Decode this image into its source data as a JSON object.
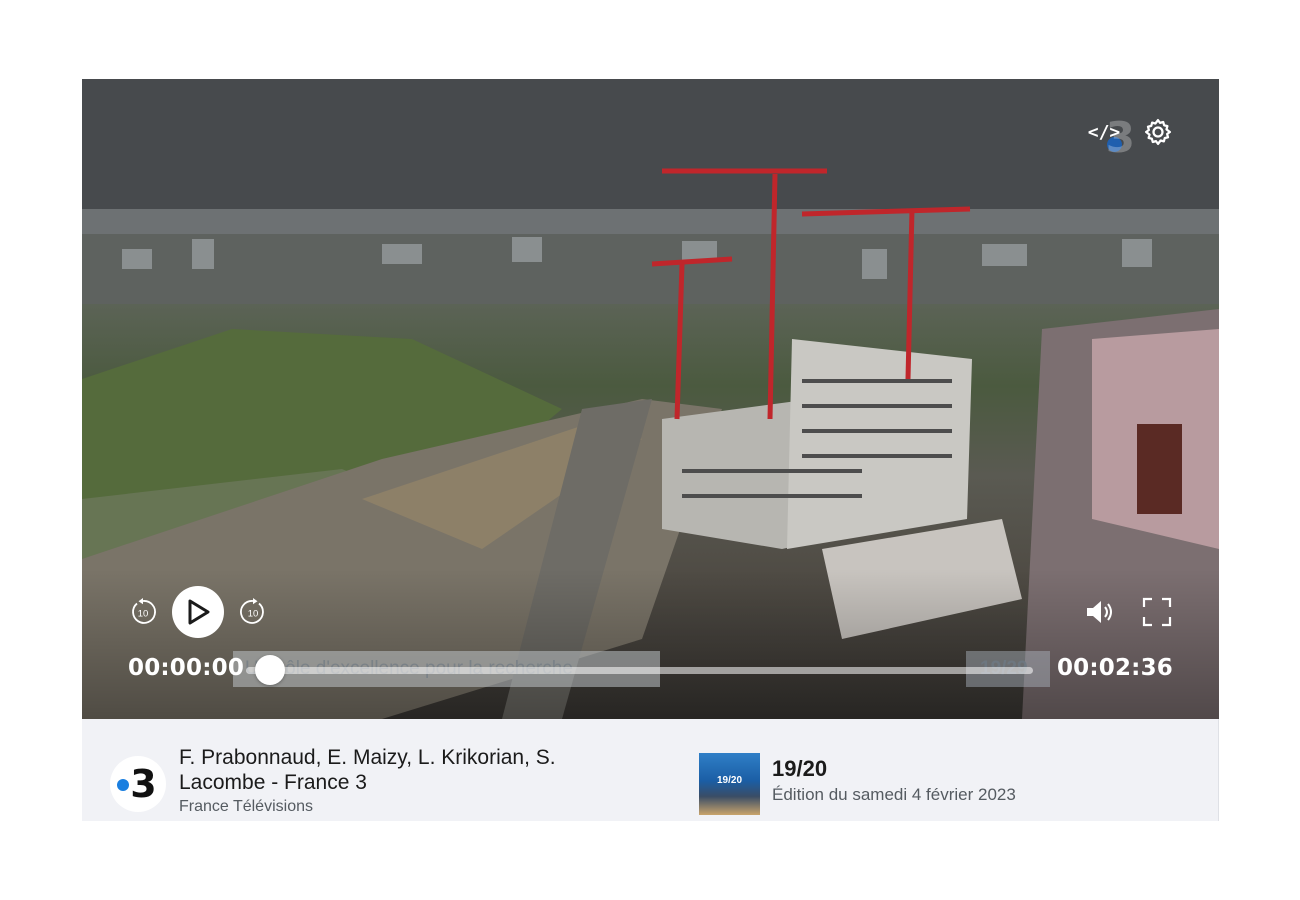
{
  "player": {
    "top_controls": {
      "embed_icon": "code-icon",
      "settings_icon": "gear-icon"
    },
    "controls": {
      "rewind_icon": "rewind-10-icon",
      "rewind_label": "10",
      "play_icon": "play-icon",
      "forward_icon": "forward-10-icon",
      "forward_label": "10",
      "volume_icon": "volume-icon",
      "fullscreen_icon": "fullscreen-icon"
    },
    "timeline": {
      "current_time": "00:00:00",
      "duration": "00:02:36",
      "chapter_title": "Un pôle d'excellence pour la recherche",
      "chapter_counter": "19/29",
      "progress": 0.0
    }
  },
  "info": {
    "channel_logo_text": "3",
    "credits": "F. Prabonnaud, E. Maizy, L. Krikorian, S. Lacombe - France 3",
    "producer": "France Télévisions",
    "program": {
      "thumb_label": "19/20",
      "title": "19/20",
      "edition": "Édition du samedi 4 février 2023"
    }
  },
  "colors": {
    "accent_blue": "#1a7fe0",
    "info_bg": "#f1f2f6"
  }
}
